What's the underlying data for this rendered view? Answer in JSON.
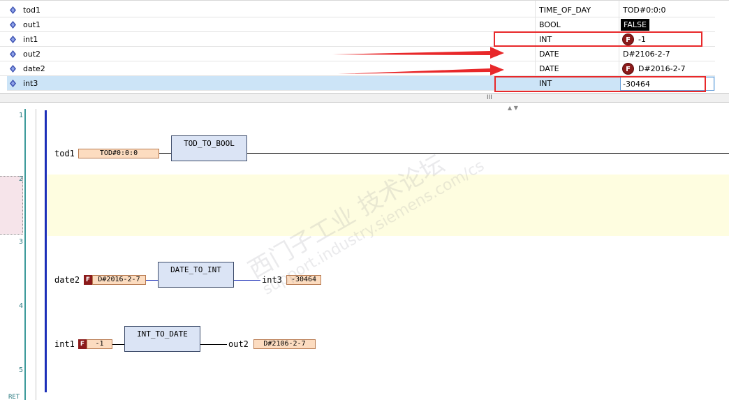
{
  "variables": [
    {
      "name": "tod1",
      "type": "TIME_OF_DAY",
      "value": "TOD#0:0:0"
    },
    {
      "name": "out1",
      "type": "BOOL",
      "value": "FALSE"
    },
    {
      "name": "int1",
      "type": "INT",
      "value": "-1",
      "forced": "F"
    },
    {
      "name": "out2",
      "type": "DATE",
      "value": "D#2106-2-7"
    },
    {
      "name": "date2",
      "type": "DATE",
      "value": "D#2016-2-7",
      "forced": "F"
    },
    {
      "name": "int3",
      "type": "INT",
      "value": "-30464"
    }
  ],
  "splitter": {
    "grip": "III",
    "arrows": "▲ ▼"
  },
  "networks": {
    "n1": "1",
    "n2": "2",
    "n3": "3",
    "n4": "4",
    "n5": "5",
    "ret": "RET"
  },
  "fbd": {
    "net1": {
      "input_name": "tod1",
      "input_value": "TOD#0:0:0",
      "block": "TOD_TO_BOOL"
    },
    "net3": {
      "input_name": "date2",
      "input_value": "D#2016-2-7",
      "force": "F",
      "block": "DATE_TO_INT",
      "output_name": "int3",
      "output_value": "-30464"
    },
    "net4": {
      "input_name": "int1",
      "input_value": "-1",
      "force": "F",
      "block": "INT_TO_DATE",
      "output_name": "out2",
      "output_value": "D#2106-2-7"
    }
  },
  "watermark": {
    "line1": "西门子工业  技术论坛",
    "line2": "support.industry.siemens.com/cs"
  },
  "colors": {
    "annotation_red": "#e8282a",
    "force_red": "#8b1a1a",
    "rail_blue": "#1c2fb8",
    "fb_fill": "#dbe4f5",
    "value_fill": "#fcdcc0"
  }
}
